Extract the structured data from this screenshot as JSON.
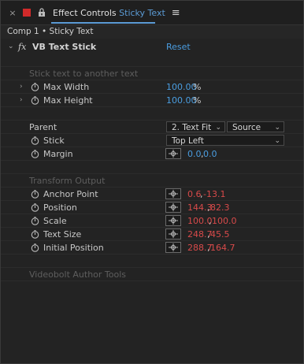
{
  "tabbar": {
    "close": "×",
    "title_prefix": "Effect Controls",
    "title_name": "Sticky Text",
    "menu": "≡"
  },
  "breadcrumb": "Comp 1 • Sticky Text",
  "effect": {
    "fx": "fx",
    "name": "VB Text Stick",
    "reset": "Reset"
  },
  "groups": {
    "stick_section": "Stick text to another text",
    "transform_section": "Transform Output",
    "author_section": "Videobolt Author Tools"
  },
  "props": {
    "max_width": {
      "label": "Max Width",
      "value": "100.00",
      "unit": "%"
    },
    "max_height": {
      "label": "Max Height",
      "value": "100.00",
      "unit": "%"
    },
    "parent": {
      "label": "Parent",
      "layer": "2. Text Fit",
      "source": "Source"
    },
    "stick": {
      "label": "Stick",
      "value": "Top Left"
    },
    "margin": {
      "label": "Margin",
      "x": "0.0",
      "y": "0.0"
    },
    "anchor_point": {
      "label": "Anchor Point",
      "x": "0.6",
      "y": "-13.1"
    },
    "position": {
      "label": "Position",
      "x": "144.3",
      "y": "82.3"
    },
    "scale": {
      "label": "Scale",
      "x": "100.0",
      "y": "100.0"
    },
    "text_size": {
      "label": "Text Size",
      "x": "248.7",
      "y": "45.5"
    },
    "initial_position": {
      "label": "Initial Position",
      "x": "288.7",
      "y": "164.7"
    }
  },
  "colors": {
    "accent": "#5b9bd5",
    "swatch": "#d12a2a",
    "expression_value": "#d84a4a",
    "value": "#4a9de0"
  }
}
